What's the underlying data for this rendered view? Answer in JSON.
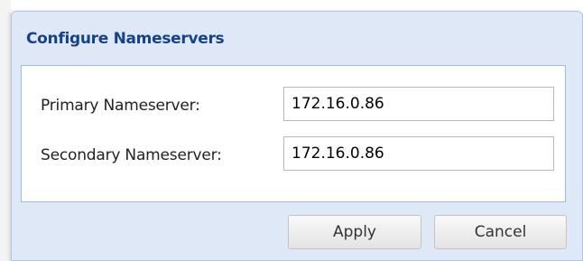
{
  "dialog": {
    "title": "Configure Nameservers",
    "fields": [
      {
        "label": "Primary Nameserver:",
        "value": "172.16.0.86"
      },
      {
        "label": "Secondary Nameserver:",
        "value": "172.16.0.86"
      }
    ],
    "buttons": {
      "apply_label": "Apply",
      "cancel_label": "Cancel"
    }
  },
  "colors": {
    "title": "#15428b",
    "dialog_background": "#dfe8f6",
    "panel_border": "#99bbe8"
  }
}
